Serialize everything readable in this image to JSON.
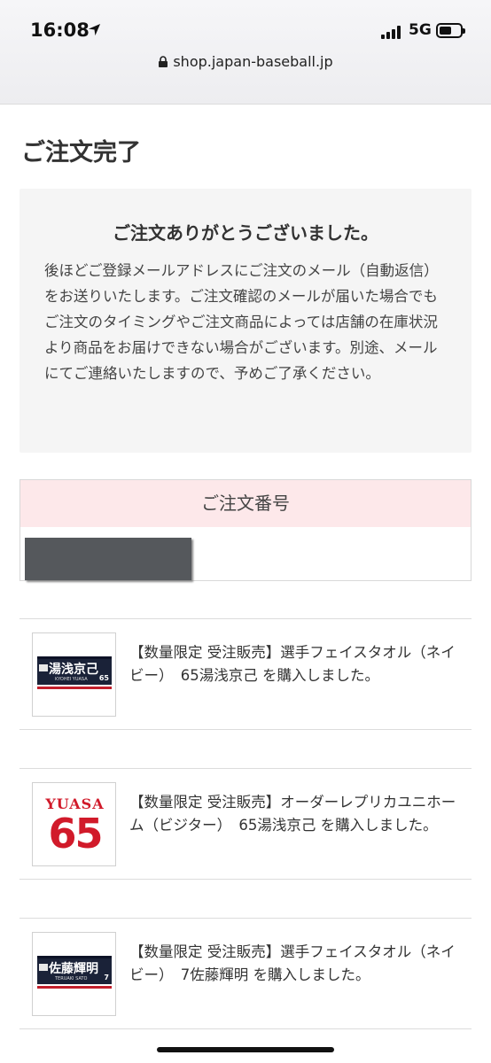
{
  "status_bar": {
    "time": "16:08",
    "network": "5G"
  },
  "address_bar": {
    "url": "shop.japan-baseball.jp"
  },
  "page": {
    "title": "ご注文完了"
  },
  "thanks": {
    "heading": "ご注文ありがとうございました。",
    "body": "後ほどご登録メールアドレスにご注文のメール（自動返信）をお送りいたします。ご注文確認のメールが届いた場合でもご注文のタイミングやご注文商品によっては店舗の在庫状況より商品をお届けできない場合がございます。別途、メールにてご連絡いたしますので、予めご了承ください。"
  },
  "order": {
    "label": "ご注文番号"
  },
  "items": [
    {
      "text": "【数量限定 受注販売】選手フェイスタオル（ネイビー）　65湯浅京己 を購入しました。",
      "thumb": {
        "name": "湯浅京己",
        "sub": "KYOHEI YUASA",
        "number": "65"
      }
    },
    {
      "text": "【数量限定 受注販売】オーダーレプリカユニホーム（ビジター）　65湯浅京己 を購入しました。",
      "thumb": {
        "name": "YUASA",
        "number": "65"
      }
    },
    {
      "text": "【数量限定 受注販売】選手フェイスタオル（ネイビー）　7佐藤輝明 を購入しました。",
      "thumb": {
        "name": "佐藤輝明",
        "sub": "TERUAKI SATO",
        "number": "7"
      }
    }
  ]
}
